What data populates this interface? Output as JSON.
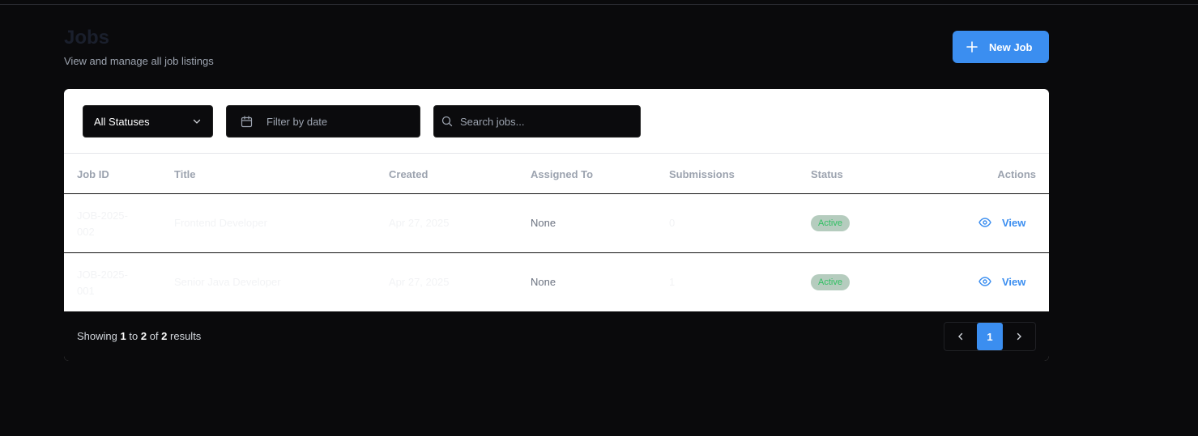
{
  "header": {
    "title": "Jobs",
    "subtitle": "View and manage all job listings",
    "new_job_label": "New Job"
  },
  "filters": {
    "status_value": "All Statuses",
    "date_placeholder": "Filter by date",
    "search_placeholder": "Search jobs..."
  },
  "table": {
    "columns": [
      "Job ID",
      "Title",
      "Created",
      "Assigned To",
      "Submissions",
      "Status",
      "Actions"
    ],
    "rows": [
      {
        "id_line1": "JOB-2025-",
        "id_line2": "002",
        "title": "Frontend Developer",
        "created": "Apr 27, 2025",
        "assigned_to": "None",
        "submissions": "0",
        "status": "Active",
        "action": "View"
      },
      {
        "id_line1": "JOB-2025-",
        "id_line2": "001",
        "title": "Senior Java Developer",
        "created": "Apr 27, 2025",
        "assigned_to": "None",
        "submissions": "1",
        "status": "Active",
        "action": "View"
      }
    ]
  },
  "footer": {
    "showing_prefix": "Showing",
    "from": "1",
    "to_word": "to",
    "to": "2",
    "of_word": "of",
    "total": "2",
    "suffix": "results",
    "current_page": "1"
  },
  "colors": {
    "accent": "#3b8ef0",
    "background": "#0a0a0c",
    "status_active_bg": "#b5ccbe",
    "status_active_text": "#2fbf62"
  }
}
